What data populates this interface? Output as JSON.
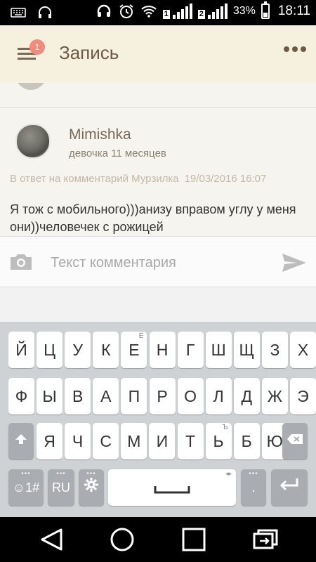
{
  "status_bar": {
    "sim1": "1",
    "sim2": "2",
    "battery": "33%",
    "time": "18:11"
  },
  "app_bar": {
    "notification_count": "1",
    "title": "Запись"
  },
  "comment": {
    "username": "Mimishka",
    "user_info": "девочка 11 месяцев",
    "reply_to": "В ответ на комментарий Мурзилка",
    "date": "19/03/2016 16:07",
    "text": "Я тож с мобильного)))анизу вправом углу у меня они))человечек с рожицей"
  },
  "comment_input": {
    "placeholder": "Текст комментария",
    "value": ""
  },
  "keyboard": {
    "row1": [
      "Й",
      "Ц",
      "У",
      "К",
      "Е",
      "Н",
      "Г",
      "Ш",
      "Щ",
      "З",
      "Х"
    ],
    "row1_hints": {
      "Е": "Ё"
    },
    "row2": [
      "Ф",
      "Ы",
      "В",
      "А",
      "П",
      "Р",
      "О",
      "Л",
      "Д",
      "Ж",
      "Э"
    ],
    "row3": [
      "Я",
      "Ч",
      "С",
      "М",
      "И",
      "Т",
      "Ь",
      "Б",
      "Ю"
    ],
    "row3_hints": {
      "Ь": "Ъ"
    },
    "emoji_label": "☺1#",
    "lang_label": "RU",
    "period_label": "."
  },
  "icons": {
    "menu": "hamburger-icon",
    "more": "more-dots-icon",
    "camera": "camera-icon",
    "send": "send-icon",
    "shift": "shift-icon",
    "backspace": "backspace-icon",
    "settings": "gear-icon",
    "enter": "enter-icon"
  },
  "colors": {
    "app_bar_bg": "#f6f0df",
    "accent_text": "#6d5a45",
    "badge": "#f08b7e",
    "keyboard_bg": "#cfd2d5"
  }
}
